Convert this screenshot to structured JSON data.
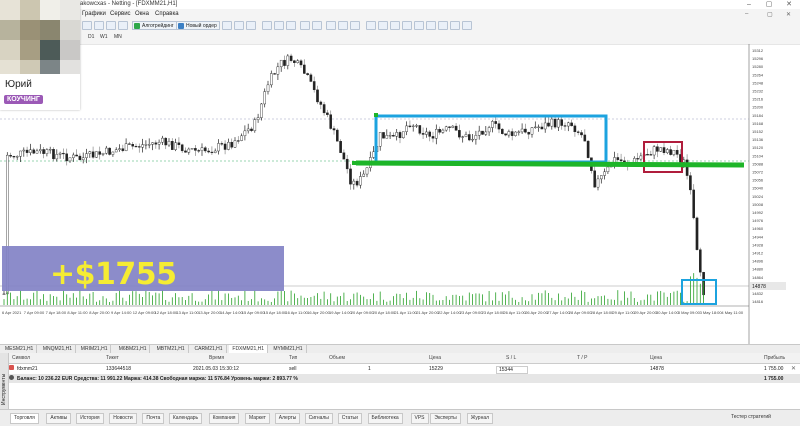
{
  "window": {
    "title": "akowcxas - Netting - [FDXMM21,H1]",
    "controls": [
      "–",
      "▢",
      "✕"
    ]
  },
  "menu": {
    "items": [
      "Графики",
      "Сервис",
      "Окна",
      "Справка"
    ],
    "right_controls": [
      "–",
      "▢",
      "✕"
    ]
  },
  "toolbar": {
    "algo_label": "Алготрейдинг",
    "new_order_label": "Новый ордер"
  },
  "timeframes": [
    "D1",
    "W1",
    "MN"
  ],
  "user_card": {
    "name": "Юрий",
    "badge": "КОУЧИНГ",
    "badge_color": "#9b59b6"
  },
  "profit_overlay": {
    "text": "+$1755",
    "text_color": "#f5ec33",
    "bg_color": "#8282c6"
  },
  "chart": {
    "symbol": "FDXMM21,H1",
    "price_labels": [
      "15312",
      "15296",
      "15280",
      "15264",
      "15248",
      "15232",
      "15216",
      "15200",
      "15184",
      "15168",
      "15152",
      "15136",
      "15120",
      "15104",
      "15088",
      "15072",
      "15056",
      "15040",
      "15024",
      "15008",
      "14992",
      "14976",
      "14960",
      "14944",
      "14928",
      "14912",
      "14896",
      "14880",
      "14864",
      "14848",
      "14832",
      "14816"
    ],
    "time_labels": [
      "6 Apr 2021",
      "7 Apr 09:00",
      "7 Apr 18:00",
      "8 Apr 11:00",
      "8 Apr 20:00",
      "9 Apr 14:00",
      "12 Apr 09:00",
      "12 Apr 18:00",
      "13 Apr 11:00",
      "13 Apr 20:00",
      "14 Apr 14:00",
      "15 Apr 09:00",
      "15 Apr 18:00",
      "16 Apr 11:00",
      "16 Apr 20:00",
      "19 Apr 14:00",
      "20 Apr 09:00",
      "20 Apr 18:00",
      "21 Apr 11:00",
      "21 Apr 20:00",
      "22 Apr 14:00",
      "23 Apr 09:00",
      "23 Apr 18:00",
      "26 Apr 11:00",
      "26 Apr 20:00",
      "27 Apr 14:00",
      "28 Apr 09:00",
      "28 Apr 18:00",
      "29 Apr 11:00",
      "29 Apr 20:00",
      "30 Apr 14:00",
      "3 May 09:00",
      "3 May 18:00",
      "4 May 11:00"
    ],
    "current_price": "14878",
    "colors": {
      "support": "#1db528",
      "box": "#1ca3df",
      "red_box": "#b01d3c",
      "bull": "#222222",
      "bear": "#888888",
      "volume": "#28a028"
    }
  },
  "chart_tabs": [
    "MESM21,H1",
    "MNQM21,H1",
    "MRIM21,H1",
    "M6BM21,H1",
    "MBTM21,H1",
    "CARM21,H1",
    "FDXMM21,H1",
    "MYMM21,H1"
  ],
  "chart_tab_active": 6,
  "trades": {
    "headers": [
      "Символ",
      "Тикет",
      "Время",
      "Тип",
      "Объем",
      "Цена",
      "S / L",
      "T / P",
      "Цена",
      "Прибыль"
    ],
    "row": [
      "fdxmm21",
      "133644518",
      "2021.05.03 15:30:12",
      "sell",
      "1",
      "15229",
      "15344",
      "",
      "14878",
      "1 755.00"
    ],
    "balance_text": "Баланс: 10 236.22 EUR  Средства: 11 991.22  Маржа: 414.38  Свободная маржа: 11 576.84  Уровень маржи: 2 893.77 %",
    "balance_profit": "1 755.00"
  },
  "bottom_tabs": [
    "Торговля",
    "Активы",
    "История",
    "Новости",
    "Почта",
    "Календарь",
    "Компания",
    "Маркет",
    "Алерты",
    "Сигналы",
    "Статьи",
    "Библиотека",
    "VPS",
    "Эксперты",
    "Журнал"
  ],
  "bottom_tab_active": 0,
  "bottom_right": "Тестер стратегий",
  "side_label": "Инструменты"
}
